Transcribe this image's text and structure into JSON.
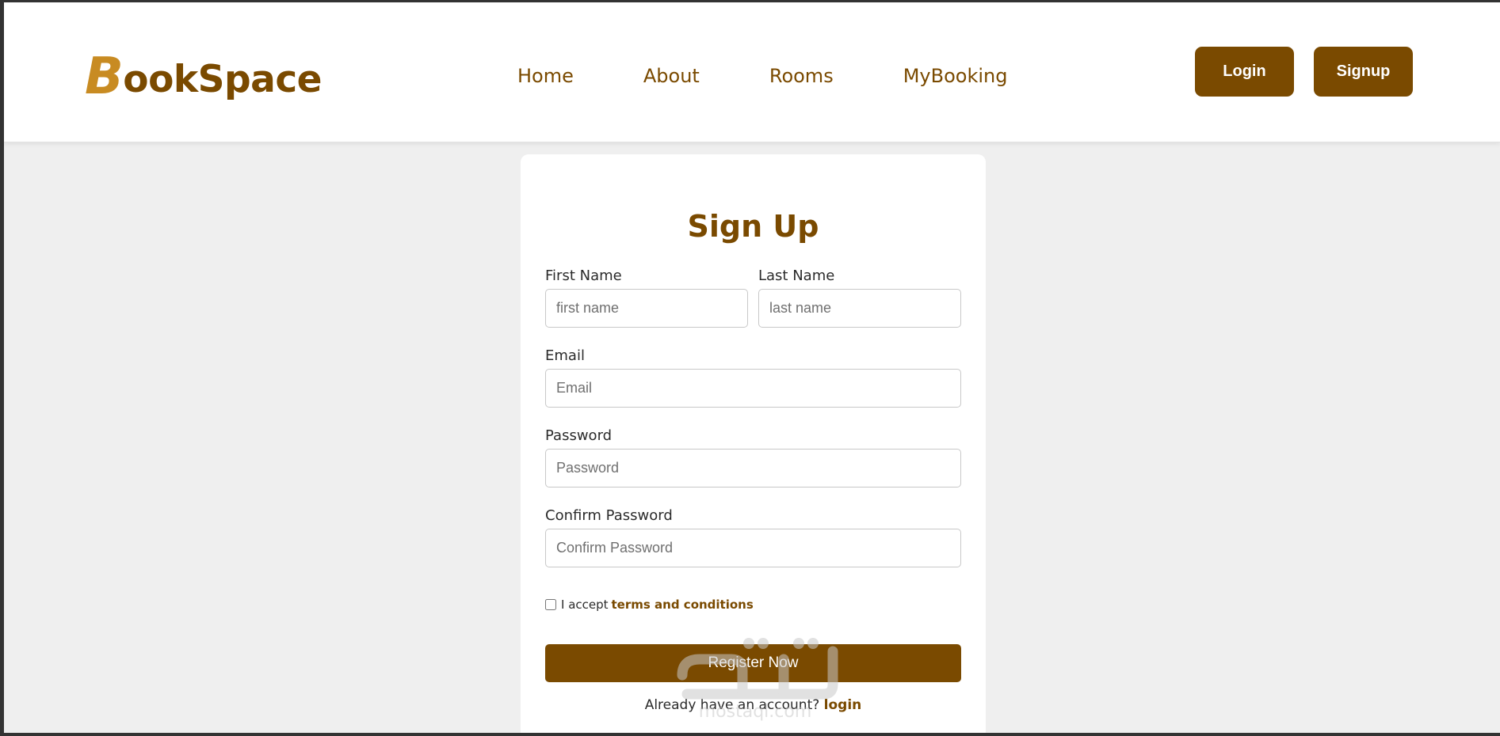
{
  "brand": {
    "initial": "B",
    "rest": "ookSpace"
  },
  "nav": {
    "links": [
      "Home",
      "About",
      "Rooms",
      "MyBooking"
    ]
  },
  "header_buttons": {
    "login": "Login",
    "signup": "Signup"
  },
  "form": {
    "title": "Sign Up",
    "first_name": {
      "label": "First Name",
      "placeholder": "first name"
    },
    "last_name": {
      "label": "Last Name",
      "placeholder": "last name"
    },
    "email": {
      "label": "Email",
      "placeholder": "Email"
    },
    "password": {
      "label": "Password",
      "placeholder": "Password"
    },
    "confirm_password": {
      "label": "Confirm Password",
      "placeholder": "Confirm Password"
    },
    "terms_prefix": "I accept",
    "terms_link": "terms and conditions",
    "terms_checked": false,
    "submit": "Register Now",
    "login_prompt": "Already have an account?",
    "login_link": "login"
  },
  "watermark": {
    "text": "mostaql.com"
  },
  "colors": {
    "brand": "#7a4a00",
    "brand_accent": "#c88b22",
    "page_bg": "#efefef"
  }
}
